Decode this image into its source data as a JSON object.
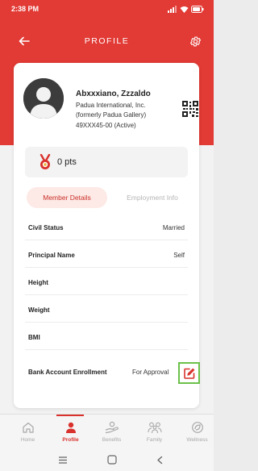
{
  "status_bar": {
    "time": "2:38 PM"
  },
  "app_bar": {
    "title": "PROFILE"
  },
  "profile": {
    "name": "Abxxxiano, Zzzaldo",
    "company": "Padua International, Inc.",
    "company_sub": "(formerly Padua Gallery)",
    "member_id": "49XXX45-00 (Active)"
  },
  "points": {
    "label": "0 pts"
  },
  "tabs": [
    {
      "label": "Member Details",
      "active": true
    },
    {
      "label": "Employment Info",
      "active": false
    }
  ],
  "details": [
    {
      "label": "Civil Status",
      "value": "Married"
    },
    {
      "label": "Principal Name",
      "value": "Self"
    },
    {
      "label": "Height",
      "value": ""
    },
    {
      "label": "Weight",
      "value": ""
    },
    {
      "label": "BMI",
      "value": ""
    }
  ],
  "bank": {
    "label": "Bank Account Enrollment",
    "status": "For Approval"
  },
  "bottom_nav": [
    {
      "label": "Home",
      "icon": "home-icon",
      "active": false
    },
    {
      "label": "Profile",
      "icon": "profile-icon",
      "active": true
    },
    {
      "label": "Benefits",
      "icon": "benefits-icon",
      "active": false
    },
    {
      "label": "Family",
      "icon": "family-icon",
      "active": false
    },
    {
      "label": "Wellness",
      "icon": "wellness-icon",
      "active": false
    }
  ],
  "colors": {
    "brand_red": "#e23a35",
    "active_tab_bg": "#fde9e5",
    "active_tab_text": "#c9302c",
    "edit_highlight": "#6cc04a"
  }
}
